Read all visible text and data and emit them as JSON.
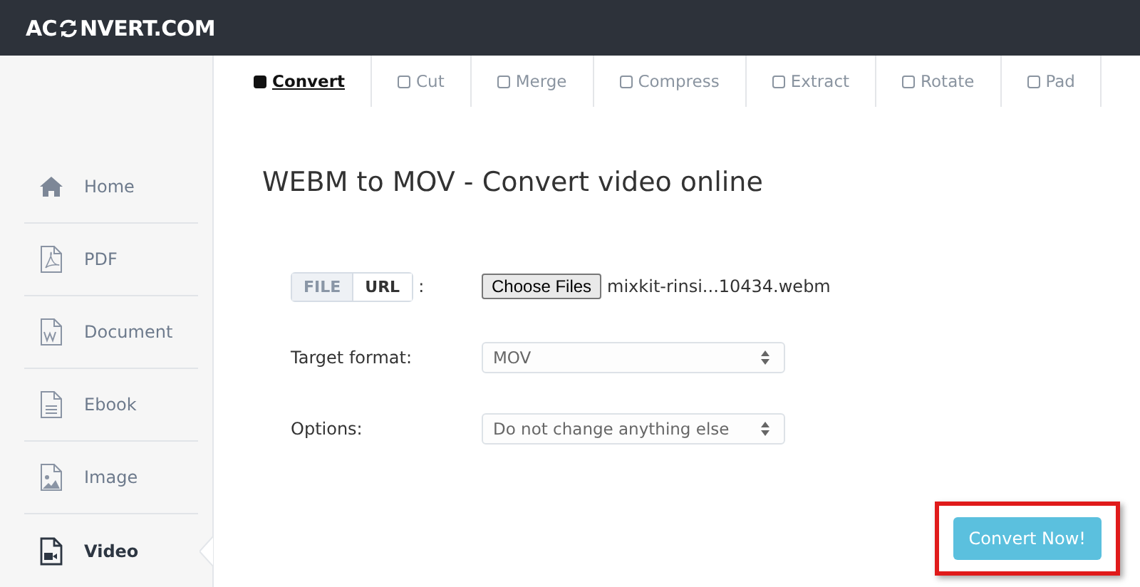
{
  "header": {
    "logo_left": "AC",
    "logo_right": "NVERT.COM"
  },
  "tabs": [
    {
      "label": "Convert",
      "selected": true
    },
    {
      "label": "Cut",
      "selected": false
    },
    {
      "label": "Merge",
      "selected": false
    },
    {
      "label": "Compress",
      "selected": false
    },
    {
      "label": "Extract",
      "selected": false
    },
    {
      "label": "Rotate",
      "selected": false
    },
    {
      "label": "Pad",
      "selected": false
    }
  ],
  "sidebar": {
    "items": [
      {
        "label": "Home",
        "kind": "home",
        "selected": false
      },
      {
        "label": "PDF",
        "kind": "pdf",
        "selected": false
      },
      {
        "label": "Document",
        "kind": "document",
        "selected": false
      },
      {
        "label": "Ebook",
        "kind": "ebook",
        "selected": false
      },
      {
        "label": "Image",
        "kind": "image",
        "selected": false
      },
      {
        "label": "Video",
        "kind": "video",
        "selected": true
      }
    ]
  },
  "title": "WEBM to MOV - Convert video online",
  "source": {
    "toggle": [
      {
        "label": "FILE",
        "selected": true
      },
      {
        "label": "URL",
        "selected": false
      }
    ],
    "colon": ":",
    "choose_button": "Choose Files",
    "file_name": "mixkit-rinsi...10434.webm"
  },
  "fields": [
    {
      "label": "Target format:",
      "value": "MOV"
    },
    {
      "label": "Options:",
      "value": "Do not change anything else"
    }
  ],
  "convert_button": {
    "label": "Convert Now!",
    "highlighted": true
  }
}
